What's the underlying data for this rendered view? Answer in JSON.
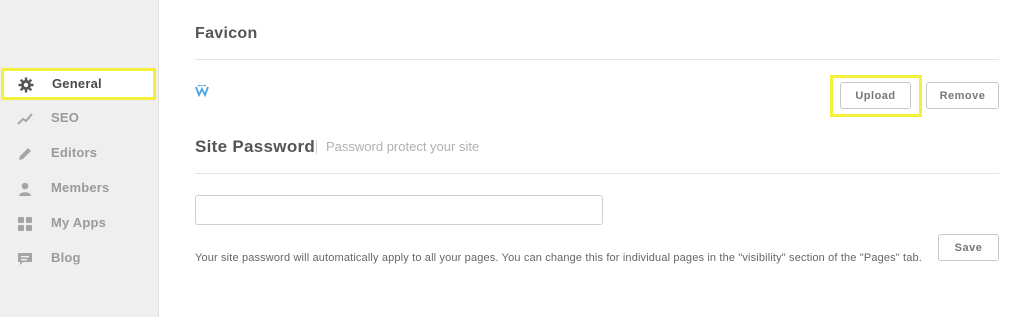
{
  "sidebar": {
    "items": [
      {
        "label": "General",
        "icon": "gear-icon",
        "active": true
      },
      {
        "label": "SEO",
        "icon": "trend-icon"
      },
      {
        "label": "Editors",
        "icon": "pencil-icon"
      },
      {
        "label": "Members",
        "icon": "person-icon"
      },
      {
        "label": "My Apps",
        "icon": "apps-grid-icon"
      },
      {
        "label": "Blog",
        "icon": "comment-icon"
      }
    ]
  },
  "favicon": {
    "title": "Favicon",
    "upload_label": "Upload",
    "remove_label": "Remove"
  },
  "password": {
    "title": "Site Password",
    "subtitle": "Password protect your site",
    "value": "",
    "description": "Your site password will automatically apply to all your pages. You can change this for individual pages in the \"visibility\" section of the \"Pages\" tab.",
    "save_label": "Save"
  },
  "colors": {
    "highlight": "#f4f03a",
    "favicon_blue": "#4aa3df"
  }
}
